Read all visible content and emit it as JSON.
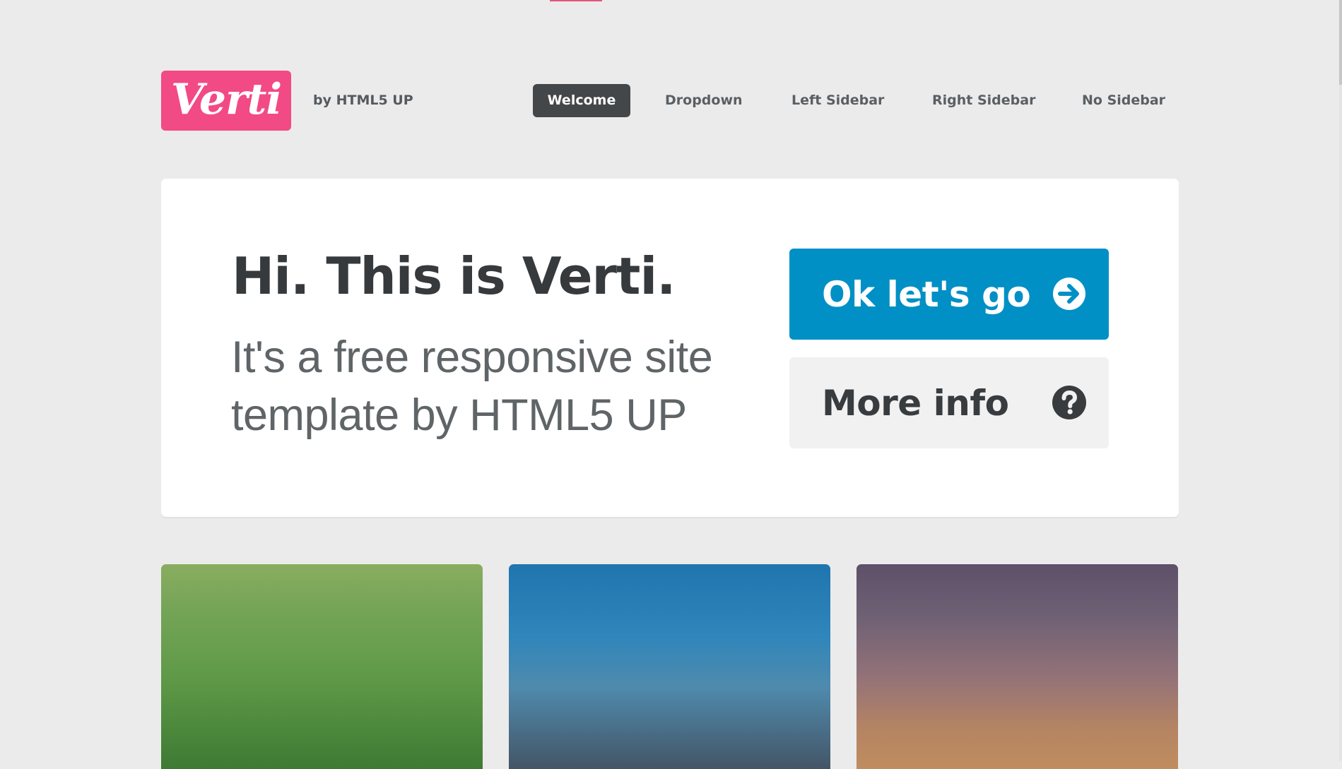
{
  "header": {
    "logo_text": "Verti",
    "tagline": "by HTML5 UP",
    "nav": [
      {
        "label": "Welcome",
        "active": true
      },
      {
        "label": "Dropdown",
        "active": false
      },
      {
        "label": "Left Sidebar",
        "active": false
      },
      {
        "label": "Right Sidebar",
        "active": false
      },
      {
        "label": "No Sidebar",
        "active": false
      }
    ]
  },
  "banner": {
    "headline": "Hi. This is Verti.",
    "subline_1": "It's a free responsive site",
    "subline_2": "template by HTML5 UP",
    "primary_button": {
      "label": "Ok let's go",
      "icon": "arrow-right-circle-icon"
    },
    "secondary_button": {
      "label": "More info",
      "icon": "question-circle-icon"
    }
  },
  "colors": {
    "brand_pink": "#f24a84",
    "primary_blue": "#0090c5",
    "nav_active": "#444749",
    "background": "#ebebeb"
  },
  "tiles": [
    {
      "theme": "green"
    },
    {
      "theme": "blue"
    },
    {
      "theme": "purple-orange"
    }
  ]
}
